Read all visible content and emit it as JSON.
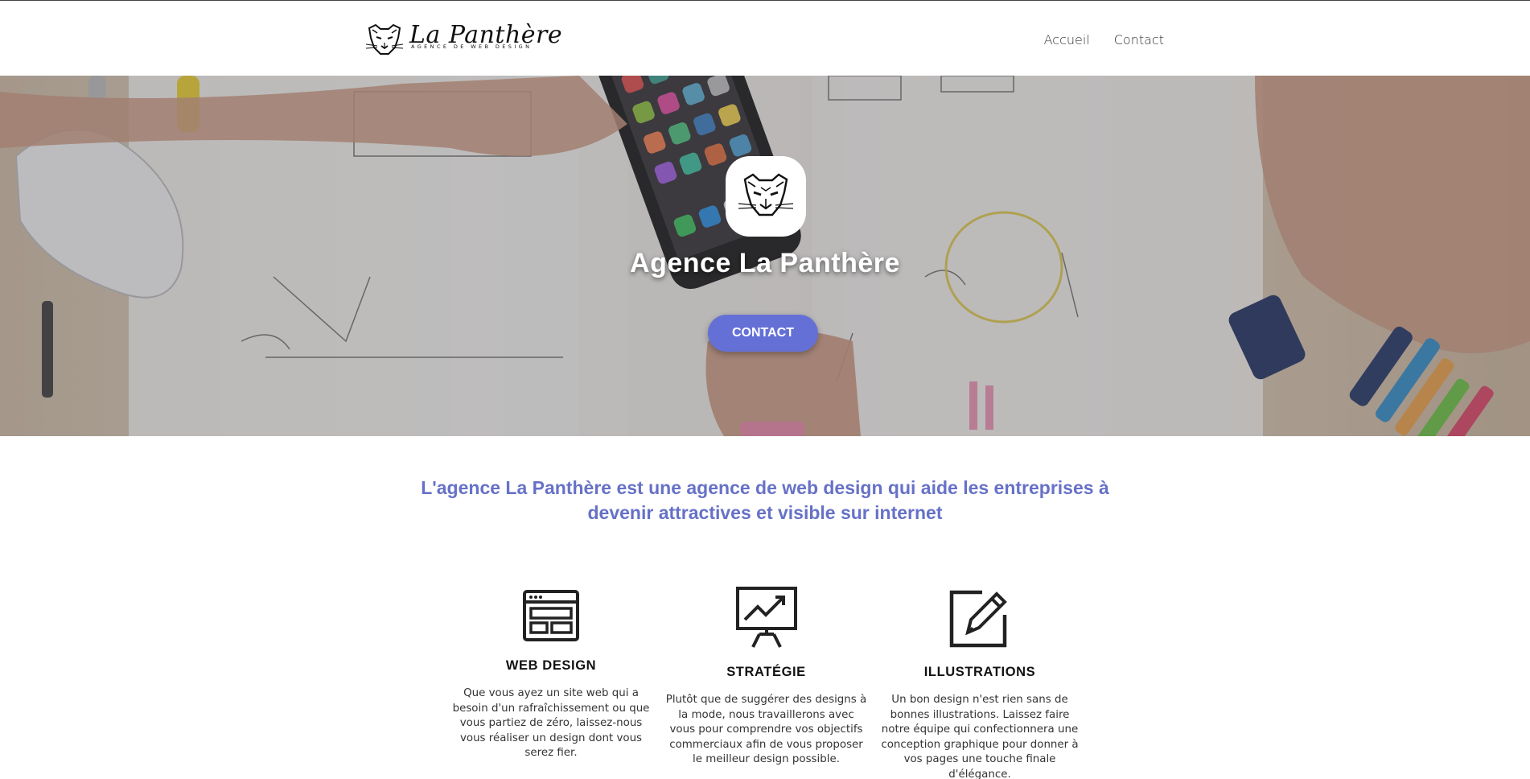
{
  "header": {
    "logo_title": "La Panthère",
    "logo_subtitle": "AGENCE DE WEB DESIGN",
    "nav": [
      {
        "label": "Accueil"
      },
      {
        "label": "Contact"
      }
    ]
  },
  "hero": {
    "title": "Agence La Panthère",
    "button_label": "CONTACT"
  },
  "intro": {
    "text": "L'agence La Panthère est une agence de web design qui aide les entreprises à devenir attractives et visible sur internet"
  },
  "features": [
    {
      "icon": "browser-window-icon",
      "title": "WEB DESIGN",
      "text": "Que vous ayez un site web qui a besoin d'un rafraîchissement ou que vous partiez de zéro, laissez-nous vous réaliser un design dont vous serez fier."
    },
    {
      "icon": "presentation-chart-icon",
      "title": "STRATÉGIE",
      "text": "Plutôt que de suggérer des designs à la mode, nous travaillerons avec vous pour comprendre vos objectifs commerciaux afin de vous proposer le meilleur design possible."
    },
    {
      "icon": "pencil-edit-icon",
      "title": "ILLUSTRATIONS",
      "text": "Un bon design n'est rien sans de bonnes illustrations. Laissez faire notre équipe qui confectionnera une conception graphique pour donner à vos pages une touche finale d'élégance."
    }
  ],
  "colors": {
    "accent": "#6570d6",
    "intro_text": "#6671c7"
  }
}
